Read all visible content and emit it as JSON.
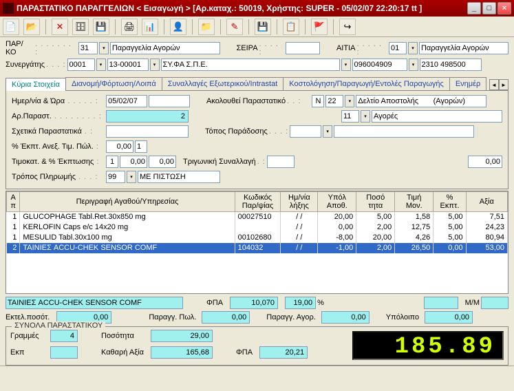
{
  "window": {
    "title": "ΠΑΡΑΣΤΑΤΙΚΟ ΠΑΡΑΓΓΕΛΙΩΝ < Εισαγωγή > [Αρ.καταχ.: 50019, Χρήστης: SUPER - 05/02/07 22:20:17 tt ]"
  },
  "header": {
    "parko_lbl": "ΠΑΡ/ΚΟ",
    "parko_code": "31",
    "parko_desc": "Παραγγελία Αγορών",
    "seira_lbl": "ΣΕΙΡΑ",
    "seira_val": "",
    "aitia_lbl": "ΑΙΤΙΑ",
    "aitia_code": "01",
    "aitia_desc": "Παραγγελία Αγορών",
    "syn_lbl": "Συνεργάτης",
    "syn_code1": "0001",
    "syn_code2": "13-00001",
    "syn_desc": "ΣΥ.ΦΑ Σ.Π.Ε.",
    "syn_phone1": "096004909",
    "syn_phone2": "2310 498500"
  },
  "tabs": {
    "t0": "Κύρια Στοιχεία",
    "t1": "Διανομή/Φόρτωση/Λοιπά",
    "t2": "Συναλλαγές Εξωτερικού/Intrastat",
    "t3": "Κοστολόγηση/Παραγωγή/Εντολές Παραγωγής",
    "t4": "Ενημέρ"
  },
  "main": {
    "date_lbl": "Ημερ/νία & Ώρα",
    "date_val": "05/02/07",
    "follow_lbl": "Ακολουθεί Παραστατικό",
    "follow_n": "Ν",
    "follow_code": "22",
    "follow_desc": "Δελτίο Αποστολής       (Αγορών)",
    "arpar_lbl": "Αρ.Παραστ.",
    "arpar_val": "2",
    "code11": "11",
    "code11_desc": "Αγορές",
    "sxet_lbl": "Σχετικά Παραστατικά",
    "topos_lbl": "Τόπος Παράδοσης",
    "ekpt_lbl": "% Έκπτ. Ανεξ. Τιμ. Πώλ.",
    "ekpt_v1": "0,00",
    "ekpt_v2": "1",
    "timokat_lbl": "Τιμοκατ. & % Έκπτωσης",
    "timokat_v1": "1",
    "timokat_v2": "0,00",
    "timokat_v3": "0,00",
    "trig_lbl": "Τριγωνική Συναλλαγή",
    "trig_val": "0,00",
    "pay_lbl": "Τρόπος Πληρωμής",
    "pay_code": "99",
    "pay_desc": "ΜΕ ΠΙΣΤΩΣΗ"
  },
  "grid": {
    "h_ap": "Α\nπ",
    "h_desc": "Περιγραφή\nΑγαθού/Υπηρεσίας",
    "h_code": "Κωδικός\nΠαρ/ψίας",
    "h_date": "Ημ/νία\nλήξης",
    "h_stock": "Υπόλ\nΑποθ.",
    "h_qty": "Ποσό\nτητα",
    "h_price": "Τιμή\nΜον.",
    "h_disc": "%\nΕκπτ.",
    "h_val": "Αξία",
    "rows": [
      {
        "ap": "1",
        "desc": "GLUCOPHAGE Tabl.Ret.30x850 mg",
        "code": "00027510",
        "date": "/ /",
        "stock": "20,00",
        "qty": "5,00",
        "price": "1,58",
        "disc": "5,00",
        "val": "7,51"
      },
      {
        "ap": "1",
        "desc": "KERLOFIN Caps e/c 14x20 mg",
        "code": "",
        "date": "/ /",
        "stock": "0,00",
        "qty": "2,00",
        "price": "12,75",
        "disc": "5,00",
        "val": "24,23"
      },
      {
        "ap": "1",
        "desc": "MESULID  Tabl.30x100 mg",
        "code": "00102680",
        "date": "/ /",
        "stock": "-8,00",
        "qty": "20,00",
        "price": "4,26",
        "disc": "5,00",
        "val": "80,94"
      },
      {
        "ap": "2",
        "desc": "ΤΑΙΝΙΕΣ ACCU-CHEK SENSOR COMF",
        "code": "104032",
        "date": "/ /",
        "stock": "-1,00",
        "qty": "2,00",
        "price": "26,50",
        "disc": "0,00",
        "val": "53,00"
      }
    ]
  },
  "footer": {
    "sel_desc": "ΤΑΙΝΙΕΣ ACCU-CHEK SENSOR COMF",
    "fpa_lbl": "ΦΠΑ",
    "fpa_val": "10,070",
    "fpa_pct": "19,00",
    "pct_sym": "%",
    "mm_lbl": "Μ/Μ",
    "ektel_lbl": "Εκτελ.ποσότ.",
    "ektel_val": "0,00",
    "parpol_lbl": "Παραγγ. Πωλ.",
    "parpol_val": "0,00",
    "parago_lbl": "Παραγγ. Αγορ.",
    "parago_val": "0,00",
    "ypol_lbl": "Υπόλοιπο",
    "ypol_val": "0,00"
  },
  "totals": {
    "legend": "ΣΥΝΟΛΑ ΠΑΡΑΣΤΑΤΙΚΟΥ",
    "lines_lbl": "Γραμμές",
    "lines_val": "4",
    "qty_lbl": "Ποσότητα",
    "qty_val": "29,00",
    "ekp_lbl": "Εκπ",
    "ekp_val": "",
    "net_lbl": "Καθαρή Αξία",
    "net_val": "165,68",
    "fpa_lbl": "ΦΠΑ",
    "fpa_val": "20,21",
    "grand": "185.89"
  }
}
